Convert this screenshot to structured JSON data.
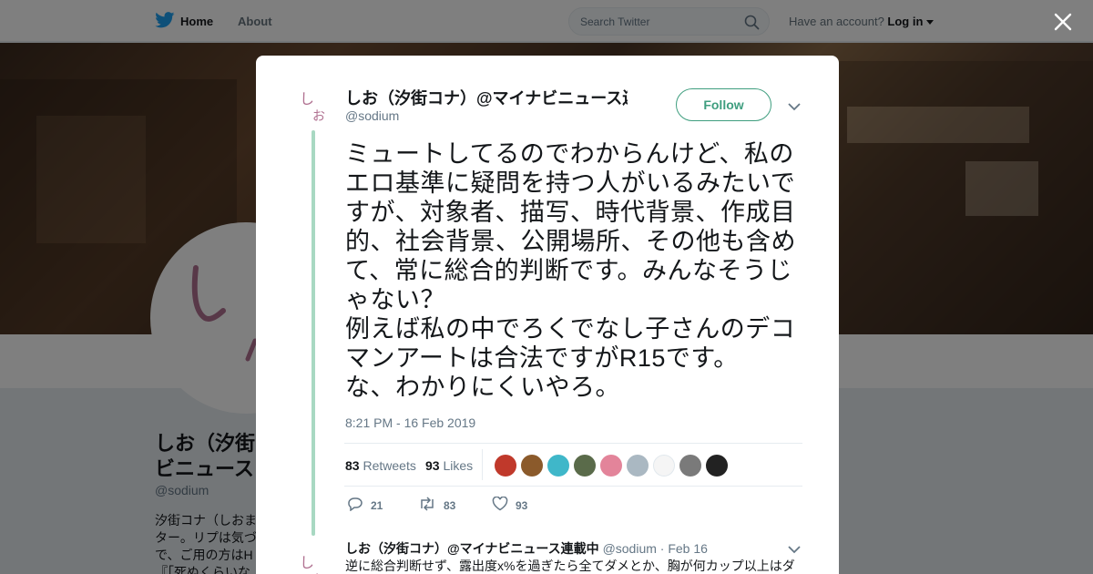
{
  "nav": {
    "home": "Home",
    "about": "About",
    "search_placeholder": "Search Twitter",
    "have_account": "Have an account?",
    "login": "Log in"
  },
  "profile": {
    "name_line1": "しお（汐街",
    "name_line2": "ビニュース",
    "handle": "@sodium",
    "bio_line1": "汐街コナ（しおま",
    "bio_line2": "ター。リプは気づ",
    "bio_line3": "で、ご用の方はH",
    "bio_line4": "『「死ぬくらいな"
  },
  "tweet": {
    "author_name": "しお（汐街コナ）@マイナビニュース連載中",
    "author_handle": "@sodium",
    "follow_label": "Follow",
    "text": "ミュートしてるのでわからんけど、私のエロ基準に疑問を持つ人がいるみたいですが、対象者、描写、時代背景、作成目的、社会背景、公開場所、その他も含めて、常に総合的判断です。みんなそうじゃない？\n例えば私の中でろくでなし子さんのデコマンアートは合法ですがR15です。\nな、わかりにくいやろ。",
    "timestamp": "8:21 PM - 16 Feb 2019",
    "retweets_count": "83",
    "retweets_label": "Retweets",
    "likes_count": "93",
    "likes_label": "Likes",
    "reply_count": "21",
    "retweet_action_count": "83",
    "like_action_count": "93",
    "avatar_glyph": "しお",
    "liker_colors": [
      "#c0392b",
      "#8b5a2b",
      "#3fb7c9",
      "#5a6b4a",
      "#e3849a",
      "#aab8c2",
      "#f5f5f5",
      "#7a7a7a",
      "#222222"
    ]
  },
  "reply": {
    "author_name": "しお（汐街コナ）@マイナビニュース連載中",
    "author_handle": "@sodium",
    "date": "· Feb 16",
    "text": "逆に総合判断せず、露出度x%を過ぎたら全てダメとか、胸が何カップ以上はダ"
  },
  "colors": {
    "accent": "#3f9e7f",
    "thread_line": "#a8d8c2",
    "twitter_blue": "#1da1f2"
  }
}
